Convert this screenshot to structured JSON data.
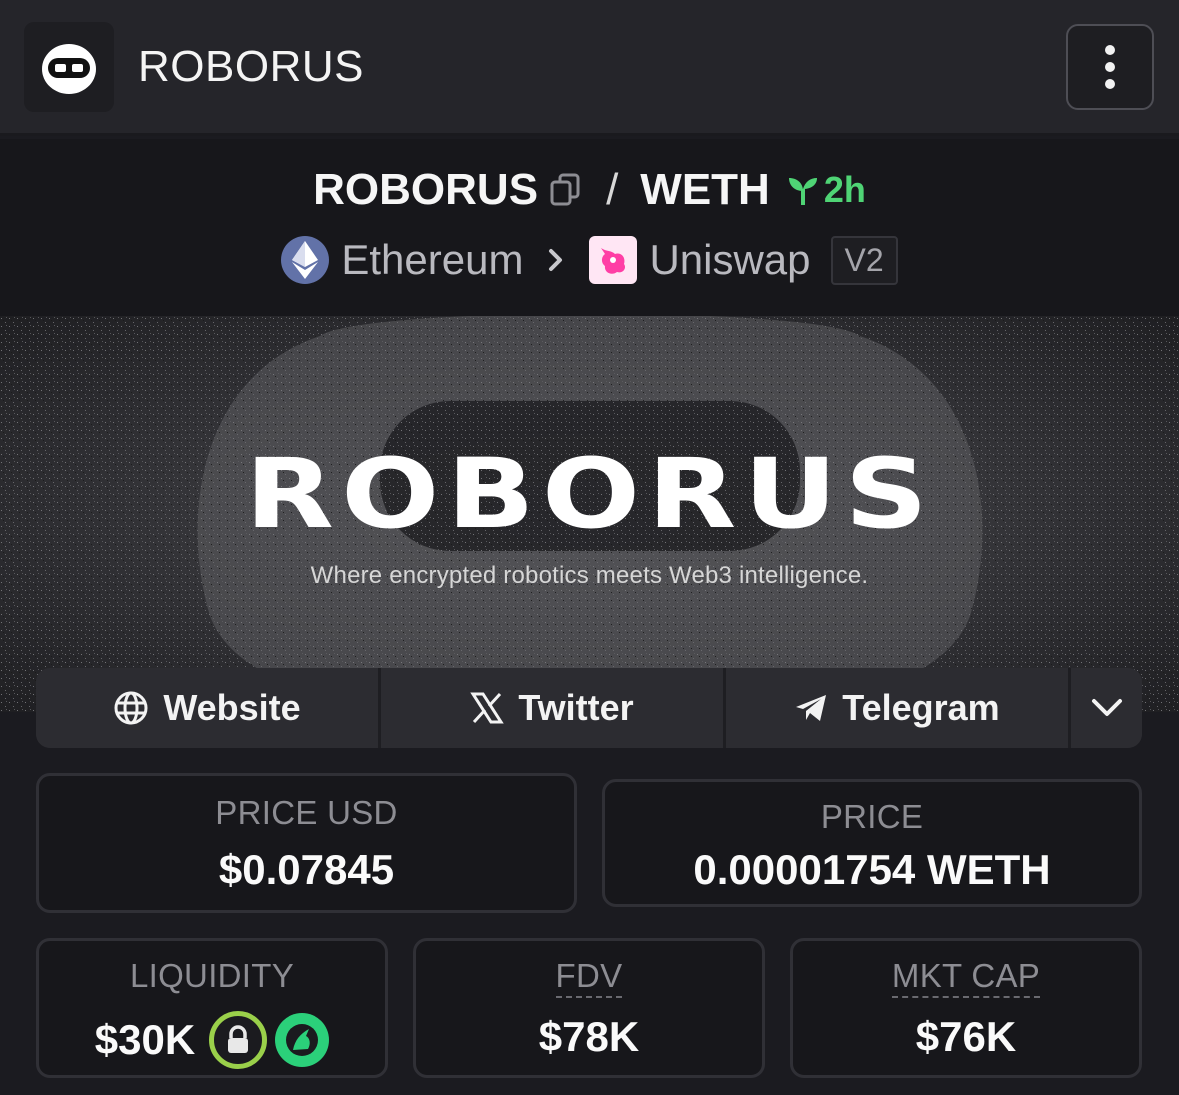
{
  "app": {
    "title": "ROBORUS"
  },
  "pair": {
    "base": "ROBORUS",
    "separator": "/",
    "quote": "WETH",
    "age": "2h",
    "chain": "Ethereum",
    "dex": "Uniswap",
    "version": "V2"
  },
  "banner": {
    "title": "ROBORUS",
    "tagline": "Where encrypted robotics meets Web3 intelligence."
  },
  "links": {
    "website": "Website",
    "twitter": "Twitter",
    "telegram": "Telegram"
  },
  "stats": {
    "price_usd_label": "PRICE USD",
    "price_usd_value": "$0.07845",
    "price_label": "PRICE",
    "price_value": "0.00001754 WETH",
    "liquidity_label": "LIQUIDITY",
    "liquidity_value": "$30K",
    "fdv_label": "FDV",
    "fdv_value": "$78K",
    "mkt_cap_label": "MKT CAP",
    "mkt_cap_value": "$76K"
  },
  "icons": {
    "app_logo": "robot-icon",
    "menu": "kebab-menu-icon",
    "copy": "copy-icon",
    "age": "seedling-icon",
    "chain": "ethereum-icon",
    "breadcrumb": "chevron-right-icon",
    "dex": "uniswap-icon",
    "website": "globe-icon",
    "twitter": "x-icon",
    "telegram": "telegram-icon",
    "more": "chevron-down-icon",
    "lock": "lock-icon",
    "uncx": "unicorn-lock-icon"
  },
  "colors": {
    "background": "#1b1b20",
    "accent_green": "#4fd475",
    "lock_ring": "#9ad04a"
  }
}
